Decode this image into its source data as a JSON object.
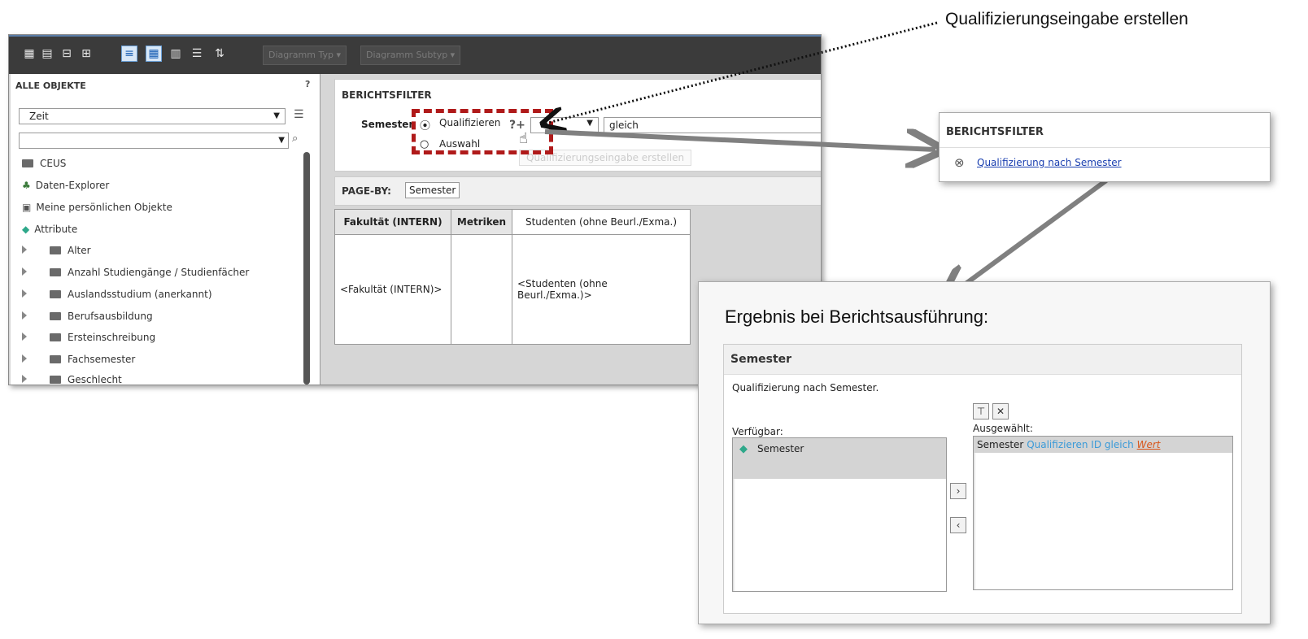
{
  "annotation": {
    "top_label": "Qualifizierungseingabe erstellen",
    "result_label": "Ergebnis bei Berichtsausführung:",
    "accent_color": "#b01a1a",
    "arrow_color": "#808080"
  },
  "toolbar": {
    "diagram_type": "Diagramm Typ",
    "diagram_subtype": "Diagramm Subtyp"
  },
  "left_panel": {
    "title": "ALLE OBJEKTE",
    "help": "?",
    "time_select": "Zeit",
    "items": [
      {
        "label": "CEUS",
        "icon": "folder-icon"
      },
      {
        "label": "Daten-Explorer",
        "icon": "tree-icon"
      },
      {
        "label": "Meine persönlichen Objekte",
        "icon": "personal-objects-icon"
      },
      {
        "label": "Attribute",
        "icon": "attribute-icon"
      }
    ],
    "folders": [
      "Alter",
      "Anzahl Studiengänge / Studienfächer",
      "Auslandsstudium (anerkannt)",
      "Berufsausbildung",
      "Ersteinschreibung",
      "Fachsemester",
      "Geschlecht"
    ]
  },
  "report_filter": {
    "title": "BERICHTSFILTER",
    "label": "Semester",
    "option_qualify": "Qualifizieren",
    "option_select": "Auswahl",
    "help_icon_text": "?+",
    "operator": "gleich",
    "tooltip": "Qualifizierungseingabe erstellen"
  },
  "page_by": {
    "label": "PAGE-BY:",
    "value": "Semester"
  },
  "grid": {
    "headers": [
      "Fakultät (INTERN)",
      "Metriken",
      "Studenten (ohne Beurl./Exma.)"
    ],
    "cells": [
      "<Fakultät (INTERN)>",
      "",
      "<Studenten (ohne Beurl./Exma.)>"
    ]
  },
  "callout_filter": {
    "title": "BERICHTSFILTER",
    "link": "Qualifizierung nach Semester"
  },
  "callout_result": {
    "title": "Semester",
    "description": "Qualifizierung nach Semester.",
    "available_label": "Verfügbar:",
    "selected_label": "Ausgewählt:",
    "available_item": "Semester",
    "selected_prefix": "Semester",
    "selected_condition": "Qualifizieren ID gleich",
    "selected_value": "Wert"
  }
}
